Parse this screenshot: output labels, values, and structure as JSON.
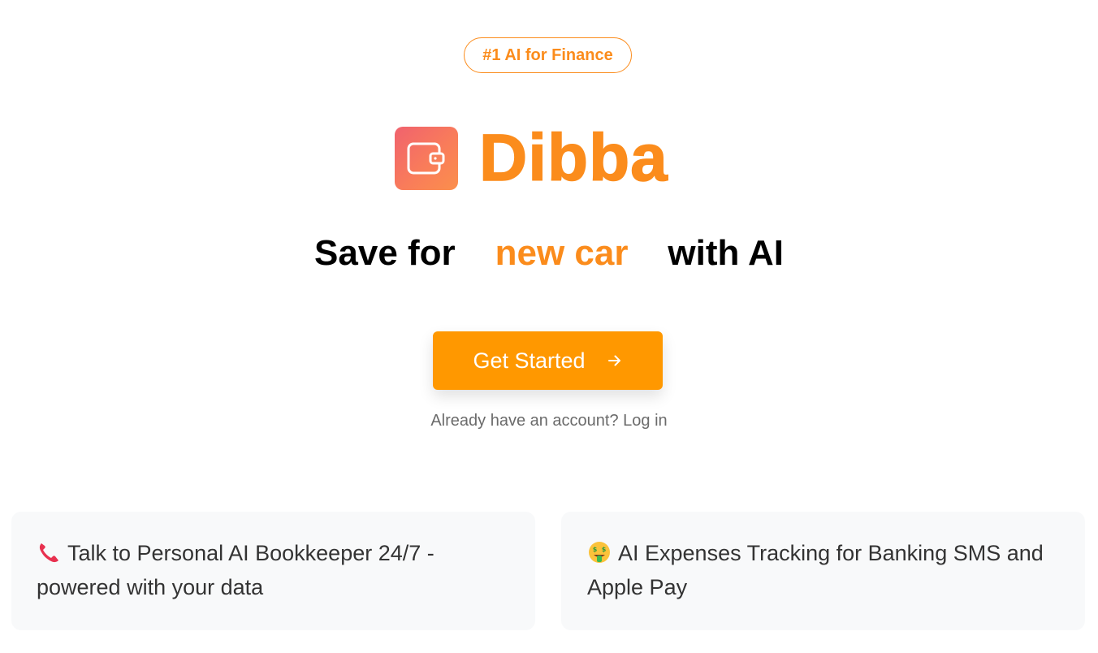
{
  "badge": {
    "text": "#1 AI for Finance"
  },
  "brand": {
    "name": "Dibba",
    "logo_icon": "wallet-icon"
  },
  "headline": {
    "prefix": "Save for",
    "highlight": "new car",
    "suffix": "with AI"
  },
  "cta": {
    "label": "Get Started",
    "icon": "arrow-right-icon"
  },
  "login": {
    "text": "Already have an account? Log in"
  },
  "features": [
    {
      "icon": "telephone-receiver-icon",
      "text": "Talk to Personal AI Bookkeeper 24/7 - powered with your data"
    },
    {
      "icon": "money-mouth-face-icon",
      "text": "AI Expenses Tracking for Banking SMS and Apple Pay"
    }
  ],
  "colors": {
    "accent": "#fb8c1c",
    "button": "#ff9800",
    "card_bg": "#f8f9fa"
  }
}
